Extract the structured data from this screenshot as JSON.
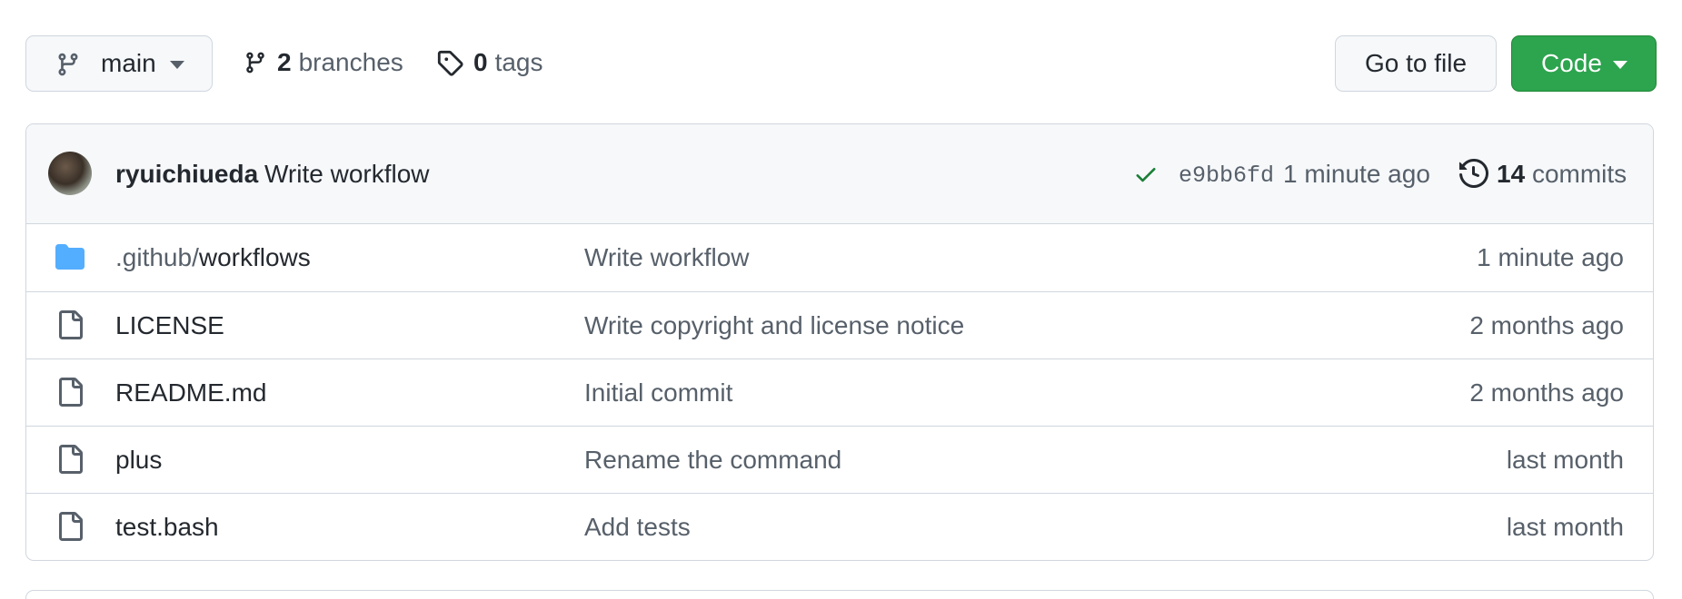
{
  "toolbar": {
    "branch": "main",
    "branches_count": "2",
    "branches_label": "branches",
    "tags_count": "0",
    "tags_label": "tags",
    "goto_file_label": "Go to file",
    "code_label": "Code"
  },
  "latest_commit": {
    "author": "ryuichiueda",
    "message": "Write workflow",
    "status": "success",
    "sha": "e9bb6fd",
    "time": "1 minute ago",
    "commits_count": "14",
    "commits_label": "commits"
  },
  "files": [
    {
      "type": "directory",
      "name_prefix": ".github/",
      "name": "workflows",
      "message": "Write workflow",
      "age": "1 minute ago"
    },
    {
      "type": "file",
      "name": "LICENSE",
      "message": "Write copyright and license notice",
      "age": "2 months ago"
    },
    {
      "type": "file",
      "name": "README.md",
      "message": "Initial commit",
      "age": "2 months ago"
    },
    {
      "type": "file",
      "name": "plus",
      "message": "Rename the command",
      "age": "last month"
    },
    {
      "type": "file",
      "name": "test.bash",
      "message": "Add tests",
      "age": "last month"
    }
  ],
  "colors": {
    "primary_button": "#2da44e",
    "folder_icon": "#54aeff",
    "success_check": "#1a7f37",
    "border": "#d0d7de"
  }
}
